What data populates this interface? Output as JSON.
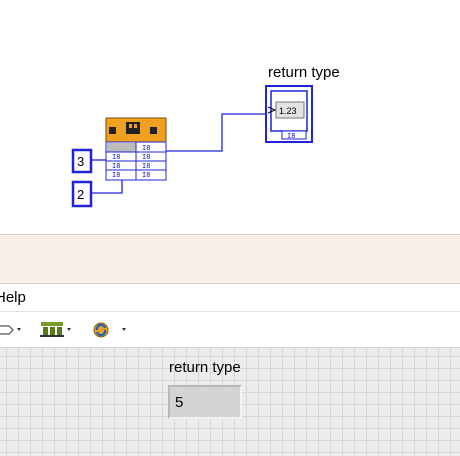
{
  "diagram": {
    "indicator_label": "return type",
    "indicator_glyph": "1.23",
    "indicator_type": "I8",
    "const_a": "3",
    "const_b": "2",
    "node_type_label": "I8"
  },
  "window": {
    "menu_help": "Help",
    "toolbar_icons": [
      "run-arrow-icon",
      "align-icon",
      "reorder-icon"
    ]
  },
  "front_panel": {
    "indicator_label": "return type",
    "indicator_value": "5"
  },
  "colors": {
    "wire": "#1f24d6",
    "node_header": "#f0a020",
    "panel_grid": "#d6d6d6"
  }
}
